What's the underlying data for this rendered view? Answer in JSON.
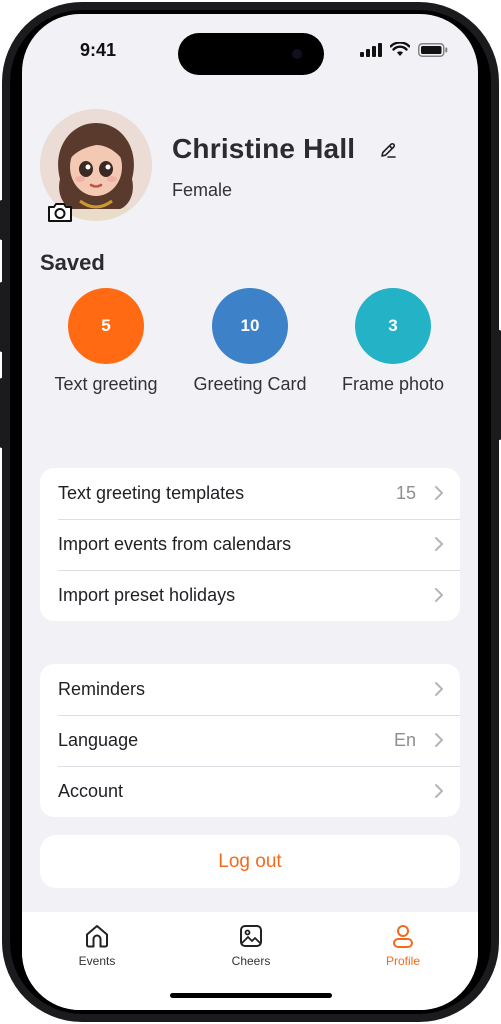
{
  "status_bar": {
    "time": "9:41"
  },
  "profile": {
    "name": "Christine Hall",
    "gender": "Female"
  },
  "saved": {
    "title": "Saved",
    "items": [
      {
        "count": "5",
        "label": "Text greeting",
        "color": "#ff6a13"
      },
      {
        "count": "10",
        "label": "Greeting Card",
        "color": "#3d82c8"
      },
      {
        "count": "3",
        "label": "Frame photo",
        "color": "#24b2c6"
      }
    ]
  },
  "settings_group_1": [
    {
      "label": "Text greeting templates",
      "value": "15"
    },
    {
      "label": "Import events from calendars",
      "value": ""
    },
    {
      "label": "Import preset holidays",
      "value": ""
    }
  ],
  "settings_group_2": [
    {
      "label": "Reminders",
      "value": ""
    },
    {
      "label": "Language",
      "value": "En"
    },
    {
      "label": "Account",
      "value": ""
    }
  ],
  "logout_label": "Log out",
  "tabs": [
    {
      "label": "Events",
      "icon": "home-icon",
      "active": false
    },
    {
      "label": "Cheers",
      "icon": "image-icon",
      "active": false
    },
    {
      "label": "Profile",
      "icon": "person-icon",
      "active": true
    }
  ],
  "accent_color": "#f46a1d"
}
